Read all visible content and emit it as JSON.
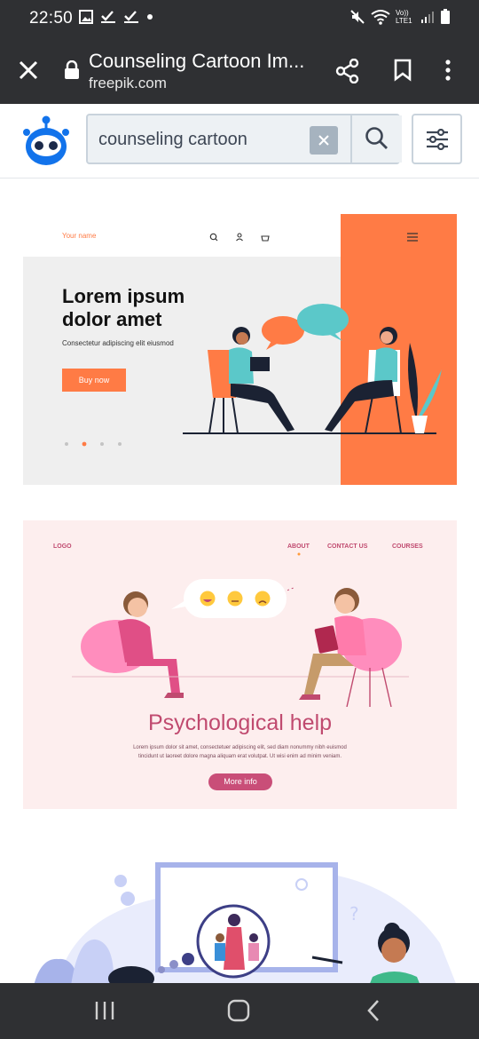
{
  "status": {
    "time": "22:50",
    "signal_label": "Vo)) LTE1"
  },
  "toolbar": {
    "title": "Counseling Cartoon Im...",
    "url": "freepik.com"
  },
  "search": {
    "value": "counseling cartoon"
  },
  "card1": {
    "your_name": "Your name",
    "headline_line1": "Lorem ipsum",
    "headline_line2": "dolor amet",
    "subtitle": "Consectetur adipiscing elit eiusmod",
    "button": "Buy now"
  },
  "card2": {
    "logo": "LOGO",
    "nav": [
      "ABOUT",
      "CONTACT US",
      "COURSES"
    ],
    "title": "Psychological help",
    "body_line1": "Lorem ipsum dolor sit amet, consectetuer adipiscing elit, sed diam nonummy nibh euismod",
    "body_line2": "tincidunt ut laoreet dolore magna aliquam erat volutpat. Ut wisi enim ad minim veniam.",
    "button": "More info"
  },
  "colors": {
    "bar_dark": "#2f3033",
    "accent_orange": "#ff7b45",
    "teal": "#5bc8c9",
    "pink_title": "#c04a6f",
    "freepik_blue": "#1273eb"
  }
}
